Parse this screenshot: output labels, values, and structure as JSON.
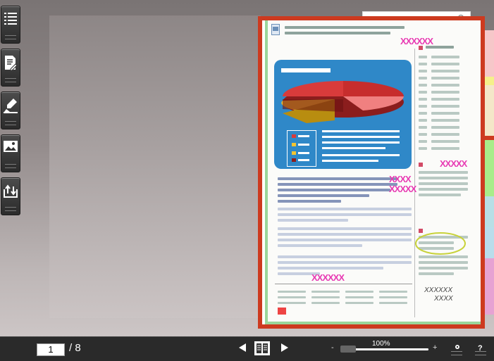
{
  "search": {
    "placeholder": "",
    "value": ""
  },
  "toolbar_left": [
    {
      "name": "table-of-contents-button",
      "icon": "list-icon"
    },
    {
      "name": "notes-button",
      "icon": "document-edit-icon"
    },
    {
      "name": "highlight-button",
      "icon": "highlighter-icon"
    },
    {
      "name": "images-button",
      "icon": "image-icon"
    },
    {
      "name": "export-button",
      "icon": "share-export-icon"
    }
  ],
  "document": {
    "annotations": [
      "XXXXXX",
      "XXXXX",
      "XXXX",
      "XXXXX",
      "XXXXXX"
    ],
    "handwriting": [
      "XXXXXX",
      "XXXX"
    ]
  },
  "pagination": {
    "current": "1",
    "separator": "/",
    "total": "8"
  },
  "zoom": {
    "label": "100%",
    "level": 1.0,
    "minus": "-",
    "plus": "+"
  },
  "help_label": "?",
  "colors": {
    "frame": "#cd3a1f",
    "panel": "#2f88c8",
    "highlight": "#e83ab3",
    "tabs": [
      "#f6c7c9",
      "#f5f08a",
      "#f4e7c8",
      "#a8ec8a",
      "#b8dfe6",
      "#b9ddeb",
      "#e6a2d3"
    ]
  }
}
